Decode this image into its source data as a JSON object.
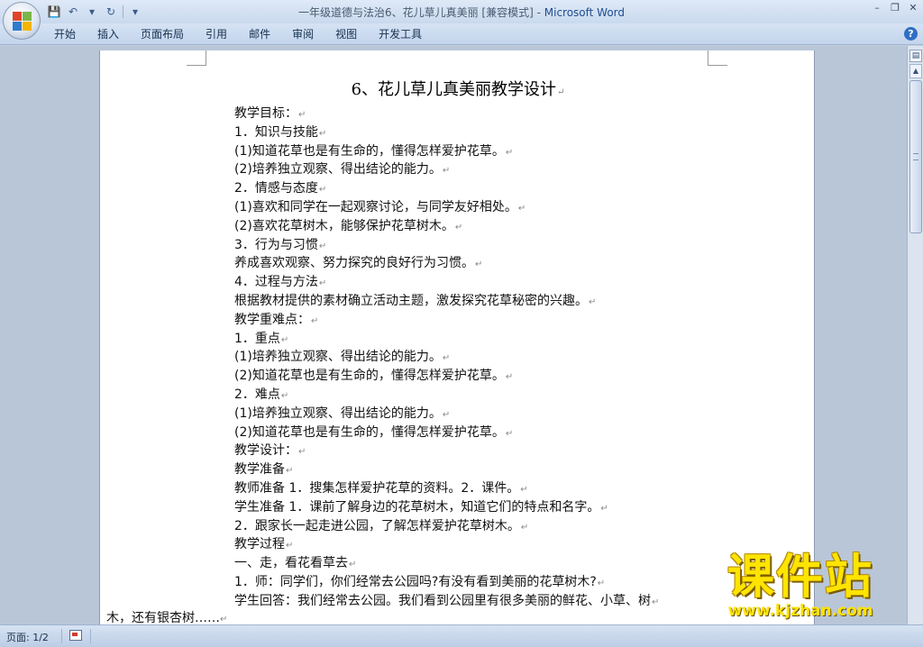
{
  "window": {
    "title": "一年级道德与法治6、花儿草儿真美丽 [兼容模式] - ",
    "app_name": "Microsoft Word",
    "minimize": "–",
    "restore": "❐",
    "close": "✕"
  },
  "quick_access": {
    "save_icon": "save-icon",
    "undo_icon": "undo-icon",
    "redo_icon": "redo-icon",
    "customize_icon": "customize-icon"
  },
  "ribbon": {
    "tabs": [
      "开始",
      "插入",
      "页面布局",
      "引用",
      "邮件",
      "审阅",
      "视图",
      "开发工具"
    ],
    "help": "?"
  },
  "document": {
    "title": "6、花儿草儿真美丽教学设计",
    "lines": [
      "教学目标：",
      "1．知识与技能",
      "(1)知道花草也是有生命的，懂得怎样爱护花草。",
      "(2)培养独立观察、得出结论的能力。",
      "2．情感与态度",
      "(1)喜欢和同学在一起观察讨论，与同学友好相处。",
      "(2)喜欢花草树木，能够保护花草树木。",
      "3．行为与习惯",
      "养成喜欢观察、努力探究的良好行为习惯。",
      "4．过程与方法",
      "根据教材提供的素材确立活动主题，激发探究花草秘密的兴趣。",
      "教学重难点：",
      "1．重点",
      "(1)培养独立观察、得出结论的能力。",
      "(2)知道花草也是有生命的，懂得怎样爱护花草。",
      "2．难点",
      "(1)培养独立观察、得出结论的能力。",
      "(2)知道花草也是有生命的，懂得怎样爱护花草。",
      "教学设计：",
      "教学准备",
      "教师准备 1．搜集怎样爱护花草的资料。2．课件。",
      "学生准备 1．课前了解身边的花草树木，知道它们的特点和名字。",
      "2．跟家长一起走进公园，了解怎样爱护花草树木。",
      "教学过程",
      "一、走，看花看草去",
      "1．师：同学们，你们经常去公园吗?有没有看到美丽的花草树木?",
      "学生回答：我们经常去公园。我们看到公园里有很多美丽的鲜花、小草、树"
    ],
    "overflow_line": "木，还有银杏树……",
    "paragraph_mark": "↵"
  },
  "watermark": {
    "main": "课件站",
    "url": "www.kjzhan.com"
  },
  "status_bar": {
    "page_info": "页面: 1/2"
  }
}
